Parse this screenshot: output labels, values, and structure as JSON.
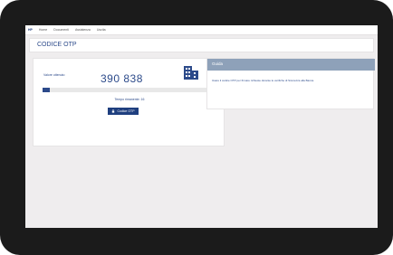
{
  "nav": {
    "brand": "HP",
    "items": [
      "Home",
      "Documenti",
      "Assistenza",
      "Uscita"
    ]
  },
  "page": {
    "title": "CODICE OTP"
  },
  "otp": {
    "label": "Valore ottenuto",
    "code": "390  838",
    "time_left": "Tempo rimanente: 16",
    "progress_fraction": 0.04,
    "button_label": "Codice OTP"
  },
  "guide": {
    "title": "Guida",
    "text": "Usare il codice OTP per firmare richieste durante le verifiche di Sicurezza alla Banca."
  },
  "colors": {
    "accent": "#2c4a8a",
    "guide_header": "#8ea1b9",
    "button": "#1f3f7f",
    "device": "#1b1b1b"
  }
}
